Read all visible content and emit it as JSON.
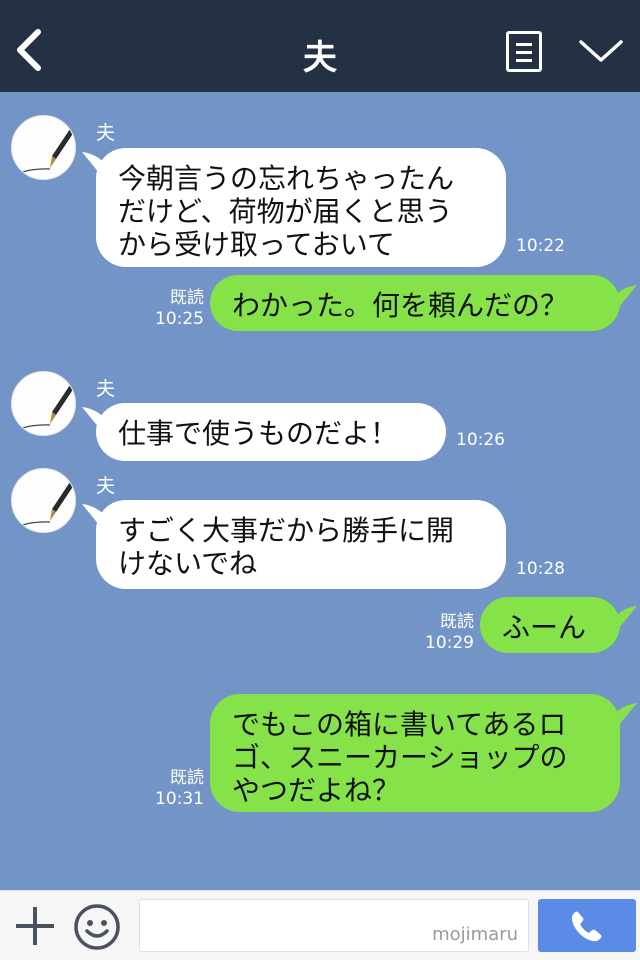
{
  "header": {
    "title": "夫",
    "icons": [
      "back-icon",
      "menu-icon",
      "chevron-down-icon"
    ],
    "background": "#243044"
  },
  "messages": [
    {
      "direction": "in",
      "sender": "夫",
      "text": "今朝言うの忘れちゃったん\nだけど、荷物が届くと思う\nから受け取っておいて",
      "time": "10:22"
    },
    {
      "direction": "out",
      "read": "既読",
      "time": "10:25",
      "text": "わかった。何を頼んだの？"
    },
    {
      "direction": "in",
      "sender": "夫",
      "text": "仕事で使うものだよ！",
      "time": "10:26"
    },
    {
      "direction": "in",
      "sender": "夫",
      "text": "すごく大事だから勝手に開\nけないでね",
      "time": "10:28"
    },
    {
      "direction": "out",
      "read": "既読",
      "time": "10:29",
      "text": "ふーん"
    },
    {
      "direction": "out",
      "read": "既読",
      "time": "10:31",
      "text": "でもこの箱に書いてあるロ\nゴ、スニーカーショップの\nやつだよね？"
    }
  ],
  "footer": {
    "watermark": "mojimaru",
    "icons": [
      "plus-icon",
      "emoji-icon",
      "phone-icon"
    ]
  },
  "colors": {
    "chat_background": "#7294c6",
    "outgoing_bubble": "#85e249",
    "incoming_bubble": "#ffffff",
    "call_button": "#5b8be6"
  }
}
